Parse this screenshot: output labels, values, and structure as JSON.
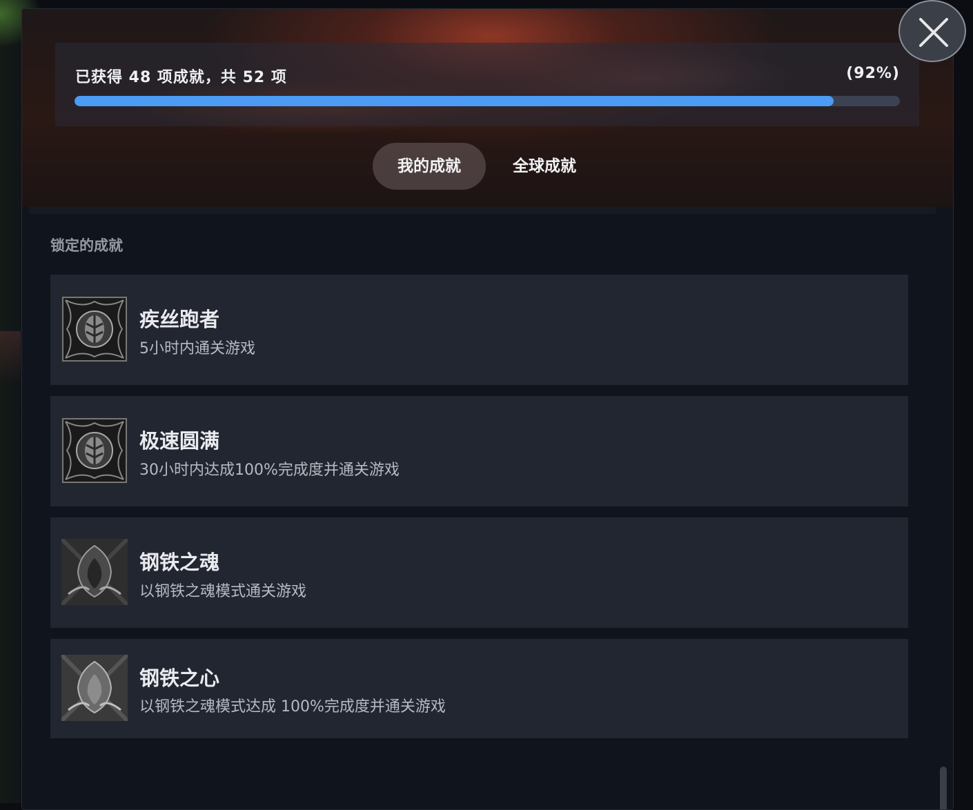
{
  "progress": {
    "text": "已获得 48 项成就，共 52 项",
    "percent_label": "(92%)",
    "fraction": 0.92
  },
  "tabs": [
    {
      "label": "我的成就",
      "active": true
    },
    {
      "label": "全球成就",
      "active": false
    }
  ],
  "section": {
    "label": "锁定的成就"
  },
  "achievements": [
    {
      "title": "疾丝跑者",
      "description": "5小时内通关游戏",
      "icon": "leaf-emblem-icon"
    },
    {
      "title": "极速圆满",
      "description": "30小时内达成100%完成度并通关游戏",
      "icon": "leaf-emblem-icon"
    },
    {
      "title": "钢铁之魂",
      "description": "以钢铁之魂模式通关游戏",
      "icon": "steel-soul-icon"
    },
    {
      "title": "钢铁之心",
      "description": "以钢铁之魂模式达成 100%完成度并通关游戏",
      "icon": "steel-heart-icon"
    }
  ],
  "colors": {
    "progress_fill": "#4c9bf4",
    "progress_track": "#3b4352",
    "card_bg": "#222630"
  },
  "close": {
    "icon": "close-icon"
  }
}
